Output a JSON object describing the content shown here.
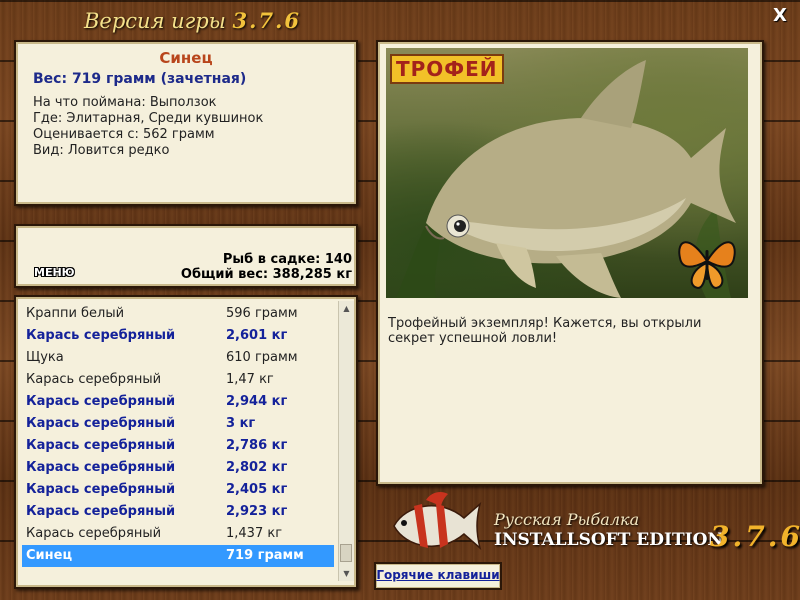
{
  "header": {
    "title_prefix": "Версия игры",
    "title_version": "3.7.6",
    "close_label": "X"
  },
  "catch_info": {
    "fish_name": "Синец",
    "weight_line": "Вес: 719 грамм (зачетная)",
    "bait_line": "На что поймана: Выползок",
    "location_line": "Где: Элитарная, Среди кувшинок",
    "threshold_line": "Оценивается с: 562 грамм",
    "rarity_line": "Вид: Ловится редко"
  },
  "stats": {
    "menu_label": "МЕНЮ",
    "fish_in_keepnet": "Рыб в садке: 140",
    "total_weight": "Общий вес: 388,285 кг"
  },
  "catch_list": [
    {
      "name": "Краппи белый",
      "weight": "596 грамм",
      "bold": false,
      "selected": false
    },
    {
      "name": "Карась серебряный",
      "weight": "2,601 кг",
      "bold": true,
      "selected": false
    },
    {
      "name": "Щука",
      "weight": "610 грамм",
      "bold": false,
      "selected": false
    },
    {
      "name": "Карась серебряный",
      "weight": "1,47 кг",
      "bold": false,
      "selected": false
    },
    {
      "name": "Карась серебряный",
      "weight": "2,944 кг",
      "bold": true,
      "selected": false
    },
    {
      "name": "Карась серебряный",
      "weight": "3 кг",
      "bold": true,
      "selected": false
    },
    {
      "name": "Карась серебряный",
      "weight": "2,786 кг",
      "bold": true,
      "selected": false
    },
    {
      "name": "Карась серебряный",
      "weight": "2,802 кг",
      "bold": true,
      "selected": false
    },
    {
      "name": "Карась серебряный",
      "weight": "2,405 кг",
      "bold": true,
      "selected": false
    },
    {
      "name": "Карась серебряный",
      "weight": "2,923 кг",
      "bold": true,
      "selected": false
    },
    {
      "name": "Карась серебряный",
      "weight": "1,437 кг",
      "bold": false,
      "selected": false
    },
    {
      "name": "Синец",
      "weight": "719 грамм",
      "bold": false,
      "selected": true
    }
  ],
  "photo": {
    "trophy_badge": "ТРОФЕЙ",
    "caption": "Трофейный экземпляр! Кажется, вы открыли секрет успешной ловли!"
  },
  "logo": {
    "line1": "Русская Рыбалка",
    "line2": "INSTALLSOFT EDITION",
    "version": "3.7.6"
  },
  "hotkeys_label": "Горячие клавиши",
  "colors": {
    "panel_bg": "#f5f0dc",
    "bold_row": "#14229a",
    "selected_row": "#3399ff",
    "fish_name": "#b8451b",
    "version_gold": "#f2b32b"
  }
}
